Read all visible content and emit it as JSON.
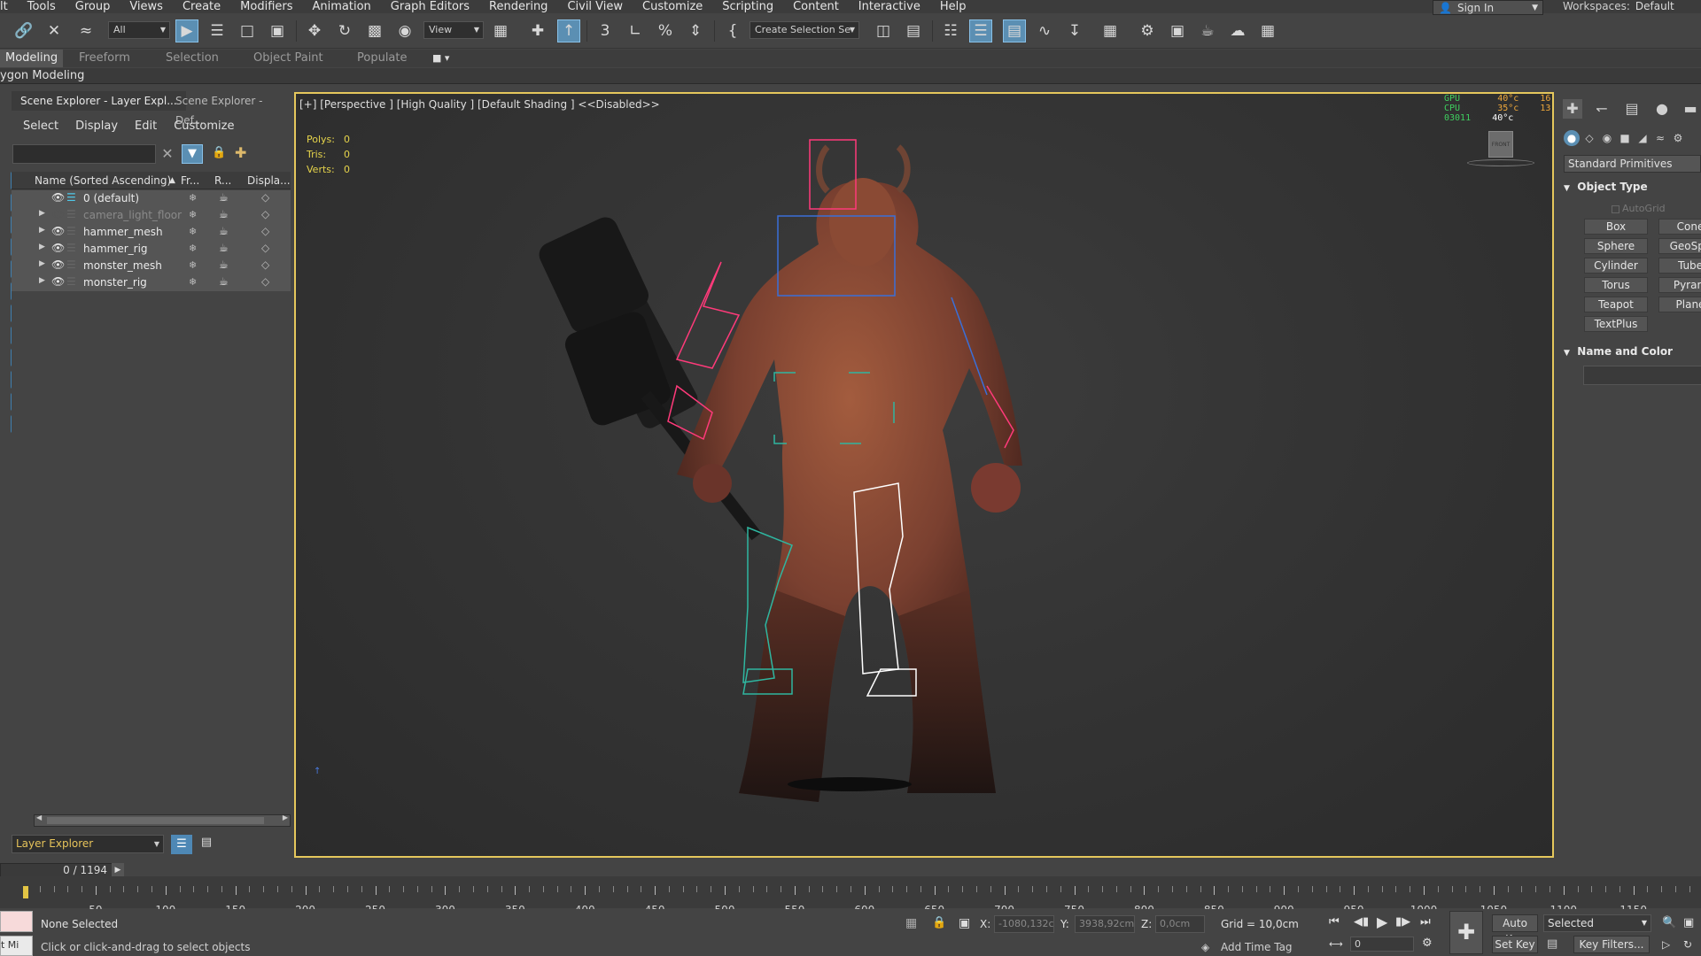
{
  "menubar": {
    "items": [
      "lt",
      "Tools",
      "Group",
      "Views",
      "Create",
      "Modifiers",
      "Animation",
      "Graph Editors",
      "Rendering",
      "Civil View",
      "Customize",
      "Scripting",
      "Content",
      "Interactive",
      "Help"
    ],
    "sign_in": "Sign In",
    "workspaces_label": "Workspaces:",
    "workspaces_value": "Default"
  },
  "toolbar": {
    "selection_filter": "All",
    "ref_coord": "View",
    "named_selection": "Create Selection Se"
  },
  "ribbon": {
    "tabs": [
      "Modeling",
      "Freeform",
      "Selection",
      "Object Paint",
      "Populate"
    ],
    "sub_title": "ygon Modeling"
  },
  "scene_explorer": {
    "tabs": [
      "Scene Explorer - Layer Expl...",
      "Scene Explorer - Def..."
    ],
    "menu": [
      "Select",
      "Display",
      "Edit",
      "Customize"
    ],
    "columns": [
      "Name (Sorted Ascending)",
      "Fr...",
      "R...",
      "Displa..."
    ],
    "rows": [
      {
        "name": "0 (default)",
        "expandable": false,
        "visible": true,
        "dimmed": false
      },
      {
        "name": "camera_light_floor",
        "expandable": true,
        "visible": false,
        "dimmed": true
      },
      {
        "name": "hammer_mesh",
        "expandable": true,
        "visible": true,
        "dimmed": false
      },
      {
        "name": "hammer_rig",
        "expandable": true,
        "visible": true,
        "dimmed": false
      },
      {
        "name": "monster_mesh",
        "expandable": true,
        "visible": true,
        "dimmed": false
      },
      {
        "name": "monster_rig",
        "expandable": true,
        "visible": true,
        "dimmed": false
      }
    ],
    "footer_dropdown": "Layer Explorer"
  },
  "frame_counter": "0 / 1194",
  "viewport": {
    "label": "[+] [Perspective ] [High Quality ] [Default Shading ]  <<Disabled>>",
    "stats": [
      {
        "label": "Polys:",
        "value": "0"
      },
      {
        "label": "Tris:",
        "value": "0"
      },
      {
        "label": "Verts:",
        "value": "0"
      }
    ],
    "perf": {
      "gpu_label": "GPU",
      "gpu_val": "40°c",
      "gpu_extra": "16",
      "cpu_label": "CPU",
      "cpu_val": "35°c",
      "cpu_extra": "13",
      "mem_label": "03011",
      "mem_val": "40°c"
    },
    "viewcube_label": "FRONT"
  },
  "command_panel": {
    "dropdown": "Standard Primitives",
    "object_type_title": "Object Type",
    "autogrid": "AutoGrid",
    "buttons": [
      "Box",
      "Cone",
      "Sphere",
      "GeoSph",
      "Cylinder",
      "Tube",
      "Torus",
      "Pyram",
      "Teapot",
      "Plane",
      "TextPlus"
    ],
    "name_color_title": "Name and Color"
  },
  "timeline": {
    "labels": [
      "50",
      "100",
      "150",
      "200",
      "250",
      "300",
      "350",
      "400",
      "450",
      "500",
      "550",
      "600",
      "650",
      "700",
      "750",
      "800",
      "850",
      "900",
      "950",
      "1000",
      "1050",
      "1100",
      "1150"
    ]
  },
  "status": {
    "maxscript": "t Mi",
    "selection": "None Selected",
    "prompt": "Click or click-and-drag to select objects",
    "x_label": "X:",
    "x_value": "-1080,132c",
    "y_label": "Y:",
    "y_value": "3938,92cm",
    "z_label": "Z:",
    "z_value": "0,0cm",
    "grid": "Grid = 10,0cm",
    "add_time_tag": "Add Time Tag",
    "frame_value": "0",
    "auto_key": "Auto Key",
    "set_key": "Set Key",
    "selected_dd": "Selected",
    "key_filters": "Key Filters..."
  },
  "colors": {
    "viewport_border": "#e5c75c",
    "accent_blue": "#5b8fb3",
    "stats_yellow": "#e6d44b",
    "monster_skin": "#8a4f36",
    "rig_pink": "#ff3a7a",
    "rig_cyan": "#2fb6a0",
    "rig_blue": "#3a6fd8"
  }
}
